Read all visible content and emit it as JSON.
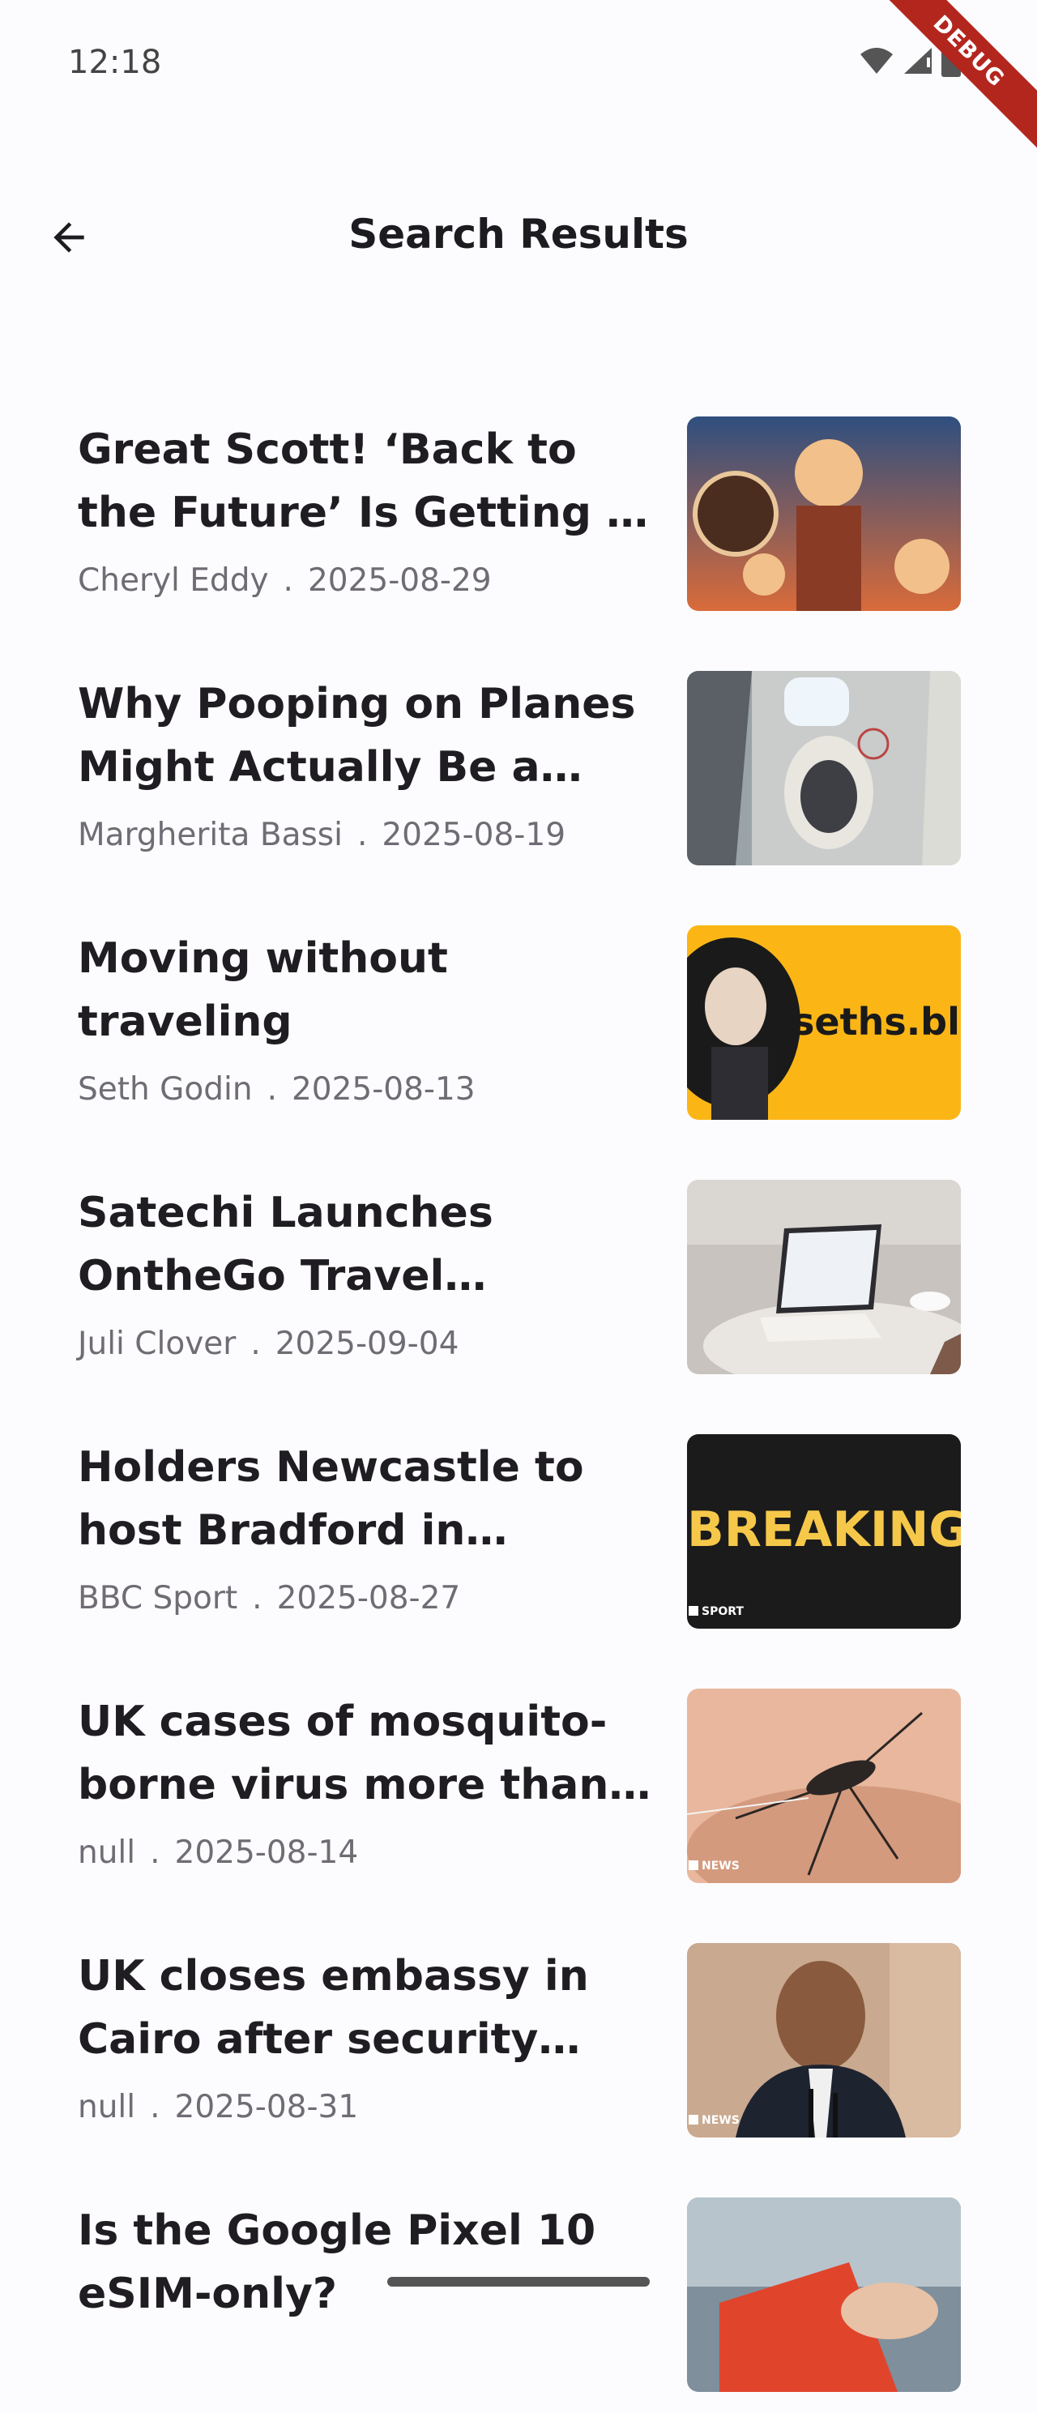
{
  "status_bar": {
    "time": "12:18",
    "debug_label": "DEBUG"
  },
  "app_bar": {
    "title": "Search Results"
  },
  "articles": [
    {
      "title": "Great Scott! ‘Back to the Future’ Is Getting a Snazzy New Release",
      "author": "Cheryl Eddy",
      "date": "2025-08-29",
      "thumb_colors": [
        "#2f4f7f",
        "#d96b3a",
        "#f2c08a"
      ]
    },
    {
      "title": "Why Pooping on Planes Might Actually Be a Good Idea",
      "author": "Margherita Bassi",
      "date": "2025-08-19",
      "thumb_colors": [
        "#9aa3a8",
        "#dcdcd6",
        "#3d3f44"
      ]
    },
    {
      "title": "Moving without traveling",
      "author": "Seth Godin",
      "date": "2025-08-13",
      "thumb_colors": [
        "#fbb616",
        "#1a1a1a",
        "#e8d4c2"
      ],
      "thumb_text": "seths.blo"
    },
    {
      "title": "Satechi Launches OntheGo Travel Bluetooth Keyboard",
      "author": "Juli Clover",
      "date": "2025-09-04",
      "thumb_colors": [
        "#c9c3bf",
        "#e9e6e2",
        "#7d5a4a"
      ]
    },
    {
      "title": "Holders Newcastle to host Bradford in Carabao Cup",
      "author": "BBC Sport",
      "date": "2025-08-27",
      "thumb_colors": [
        "#1b1b1b",
        "#f6c84a",
        "#ffffff"
      ],
      "thumb_text": "BREAKING",
      "thumb_badge": "SPORT"
    },
    {
      "title": "UK cases of mosquito-borne virus more than double",
      "author": "null",
      "date": "2025-08-14",
      "thumb_colors": [
        "#e8b79d",
        "#d49a7e",
        "#2b2624"
      ],
      "thumb_badge": "NEWS"
    },
    {
      "title": "UK closes embassy in Cairo after security barriers removed",
      "author": "null",
      "date": "2025-08-31",
      "thumb_colors": [
        "#c9a98f",
        "#1e2330",
        "#e7c8b0"
      ],
      "thumb_badge": "NEWS"
    },
    {
      "title": "Is the Google Pixel 10 eSIM-only?",
      "author": "",
      "date": "",
      "thumb_colors": [
        "#7f8f9c",
        "#e0452c",
        "#b7c4cc"
      ]
    }
  ]
}
